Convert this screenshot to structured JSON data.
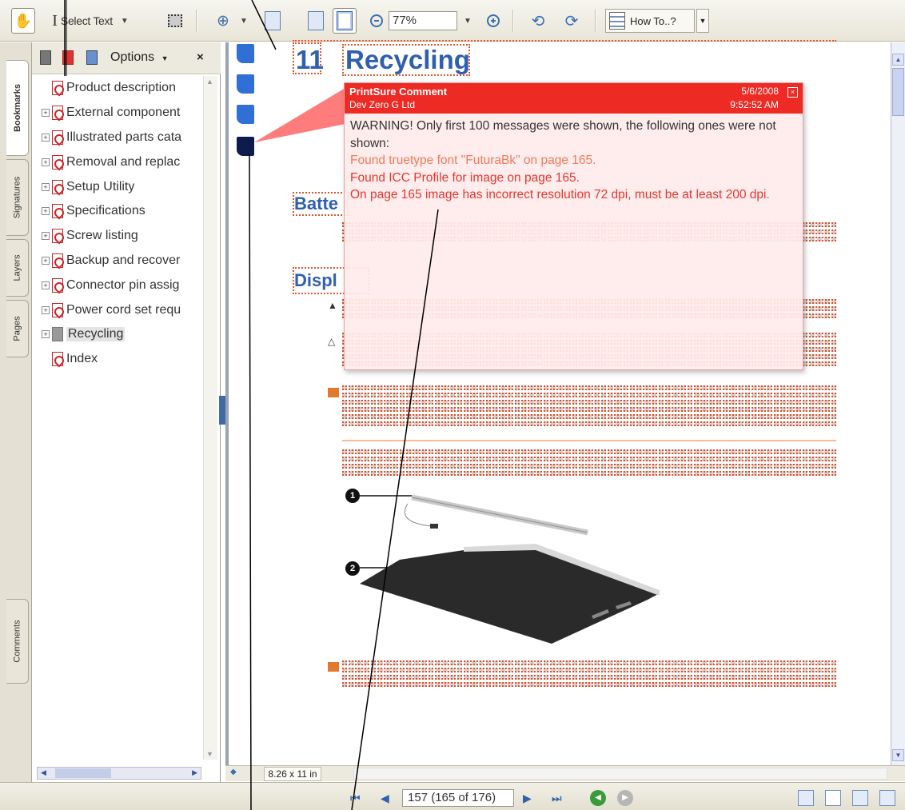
{
  "toolbar": {
    "select_text_label": "Select Text",
    "zoom_value": "77%",
    "how_to_label": "How To..?"
  },
  "tabs": [
    "Bookmarks",
    "Signatures",
    "Layers",
    "Pages",
    "Comments"
  ],
  "bookmarks": {
    "options_label": "Options",
    "close_label": "×",
    "items": [
      {
        "label": "Product description",
        "expandable": false
      },
      {
        "label": "External component",
        "expandable": true
      },
      {
        "label": "Illustrated parts cata",
        "expandable": true
      },
      {
        "label": "Removal and replac",
        "expandable": true
      },
      {
        "label": "Setup Utility",
        "expandable": true
      },
      {
        "label": "Specifications",
        "expandable": true
      },
      {
        "label": "Screw listing",
        "expandable": true
      },
      {
        "label": "Backup and recover",
        "expandable": true
      },
      {
        "label": "Connector pin assig",
        "expandable": true
      },
      {
        "label": "Power cord set requ",
        "expandable": true
      },
      {
        "label": "Recycling",
        "expandable": true,
        "selected": true
      },
      {
        "label": "Index",
        "expandable": false
      }
    ]
  },
  "document": {
    "chapter_number": "11",
    "chapter_title": "Recycling",
    "section_battery": "Batte",
    "section_display": "Displ",
    "part_labels": [
      "1",
      "2"
    ]
  },
  "comment": {
    "title": "PrintSure Comment",
    "author": "Dev Zero G Ltd",
    "date": "5/6/2008",
    "time": "9:52:52 AM",
    "close_label": "×",
    "message": "WARNING! Only first 100 messages were shown, the following ones were not shown:",
    "line_font": "Found truetype font \"FuturaBk\" on page 165.",
    "line_icc": "Found ICC Profile for image on page 165.",
    "line_resolution": "On page 165 image has incorrect resolution 72 dpi, must be at least 200 dpi."
  },
  "statusbar": {
    "page_size": "8.26 x 11 in",
    "page_field": "157  (165 of 176)"
  },
  "colors": {
    "comment_header": "#ee2a24",
    "heading_blue": "#2f5fb0",
    "preflight_orange": "#e0552c"
  }
}
